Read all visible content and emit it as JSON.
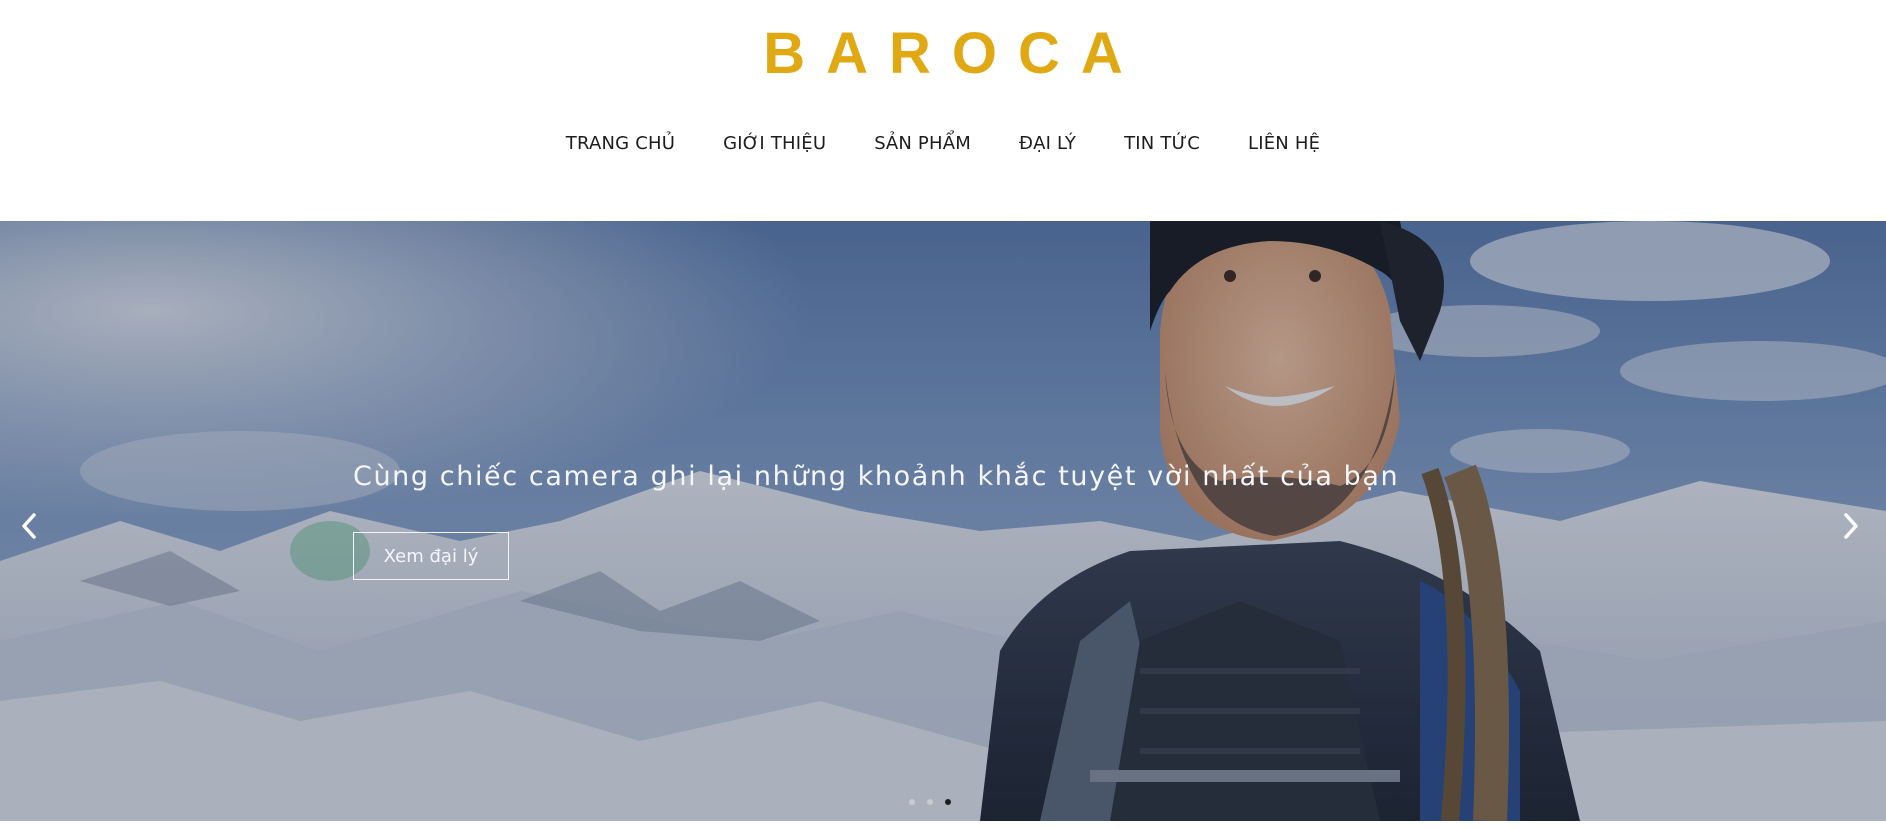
{
  "brand": {
    "name": "BAROCA",
    "color": "#e0a812"
  },
  "nav": {
    "items": [
      {
        "label": "TRANG CHỦ"
      },
      {
        "label": "GIỚI THIỆU"
      },
      {
        "label": "SẢN PHẨM"
      },
      {
        "label": "ĐẠI LÝ"
      },
      {
        "label": "TIN TỨC"
      },
      {
        "label": "LIÊN HỆ"
      }
    ]
  },
  "hero": {
    "caption": "Cùng chiếc camera ghi lại những khoảnh khắc tuyệt vời nhất của bạn",
    "button_label": "Xem đại lý",
    "prev_icon": "chevron-left-icon",
    "next_icon": "chevron-right-icon",
    "slide_count": 3,
    "active_slide": 3
  }
}
